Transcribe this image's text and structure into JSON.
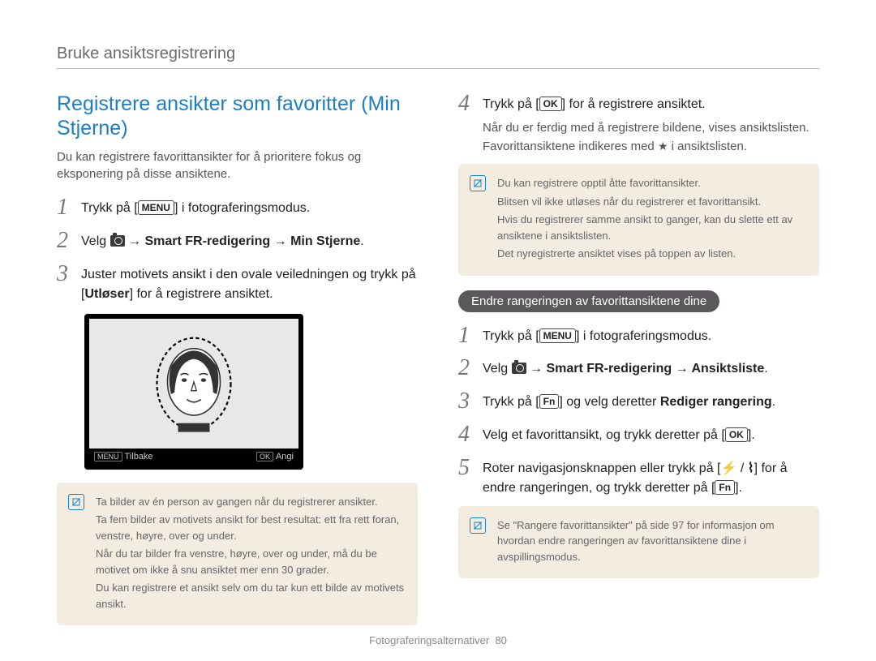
{
  "header": "Bruke ansiktsregistrering",
  "left": {
    "title": "Registrere ansikter som favoritter (Min Stjerne)",
    "intro": "Du kan registrere favorittansikter for å prioritere fokus og eksponering på disse ansiktene.",
    "steps": {
      "s1_pre": "Trykk på [",
      "s1_btn": "MENU",
      "s1_post": "] i fotograferingsmodus.",
      "s2_pre": "Velg ",
      "s2_mid": " → Smart FR-redigering → Min Stjerne",
      "s2_post": ".",
      "s3_a": "Juster motivets ansikt i den ovale veiledningen og trykk på [",
      "s3_b": "Utløser",
      "s3_c": "] for å registrere ansiktet."
    },
    "screen": {
      "back_btn": "MENU",
      "back_label": "Tilbake",
      "set_btn": "OK",
      "set_label": "Angi"
    },
    "note": {
      "l1": "Ta bilder av én person av gangen når du registrerer ansikter.",
      "l2": "Ta fem bilder av motivets ansikt for best resultat: ett fra rett foran, venstre, høyre, over og under.",
      "l3": "Når du tar bilder fra venstre, høyre, over og under, må du be motivet om ikke å snu ansiktet mer enn 30 grader.",
      "l4": "Du kan registrere et ansikt selv om du tar kun ett bilde av motivets ansikt."
    }
  },
  "right": {
    "step4_pre": "Trykk på [",
    "step4_btn": "OK",
    "step4_post": "] for å registrere ansiktet.",
    "step4_sub_a": "Når du er ferdig med å registrere bildene, vises ansiktslisten.",
    "step4_sub_b": "Favorittansiktene indikeres med ",
    "step4_sub_c": " i ansiktslisten.",
    "note1": {
      "l1": "Du kan registrere opptil åtte favorittansikter.",
      "l2": "Blitsen vil ikke utløses når du registrerer et favorittansikt.",
      "l3": "Hvis du registrerer samme ansikt to ganger, kan du slette ett av ansiktene i ansiktslisten.",
      "l4": "Det nyregistrerte ansiktet vises på toppen av listen."
    },
    "subheader": "Endre rangeringen av favorittansiktene dine",
    "r_steps": {
      "s1_pre": "Trykk på [",
      "s1_btn": "MENU",
      "s1_post": "] i fotograferingsmodus.",
      "s2_pre": "Velg ",
      "s2_mid": " → Smart FR-redigering → Ansiktsliste",
      "s2_post": ".",
      "s3_pre": "Trykk på [",
      "s3_btn": "Fn",
      "s3_post": "] og velg deretter ",
      "s3_bold": "Rediger rangering",
      "s3_end": ".",
      "s4_pre": "Velg et favorittansikt, og trykk deretter på [",
      "s4_btn": "OK",
      "s4_post": "].",
      "s5_pre": "Roter navigasjonsknappen eller trykk på [",
      "s5_mid": "] for å endre rangeringen, og trykk deretter på [",
      "s5_btn2": "Fn",
      "s5_end": "]."
    },
    "note2": "Se \"Rangere favorittansikter\" på side 97 for informasjon om hvordan endre rangeringen av favorittansiktene dine i avspillingsmodus."
  },
  "footer": {
    "label": "Fotograferingsalternativer",
    "page": "80"
  }
}
